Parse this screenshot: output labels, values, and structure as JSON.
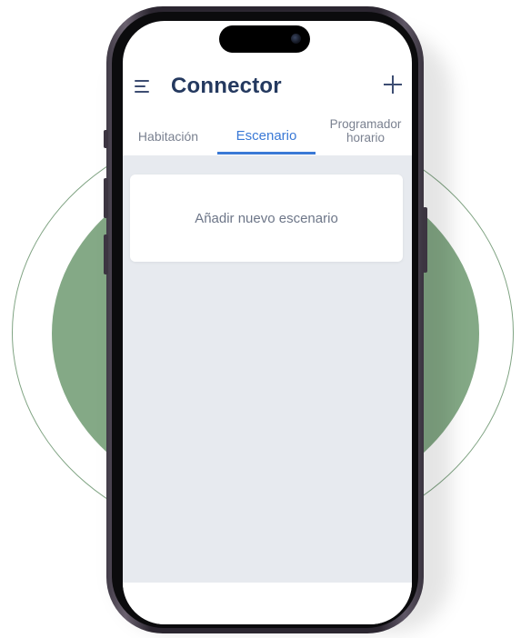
{
  "app": {
    "title": "Connector"
  },
  "header": {
    "menu_icon": "hamburger-menu-icon",
    "add_icon": "plus-icon"
  },
  "tabs": [
    {
      "label": "Habitación",
      "active": false
    },
    {
      "label": "Escenario",
      "active": true
    },
    {
      "label_line1": "Programador",
      "label_line2": "horario",
      "active": false
    }
  ],
  "scenes": {
    "add_card_label": "Añadir nuevo escenario"
  },
  "colors": {
    "accent": "#3a79d6",
    "title": "#24395f",
    "background_disc": "#84a986",
    "content_bg": "#e7eaef"
  }
}
